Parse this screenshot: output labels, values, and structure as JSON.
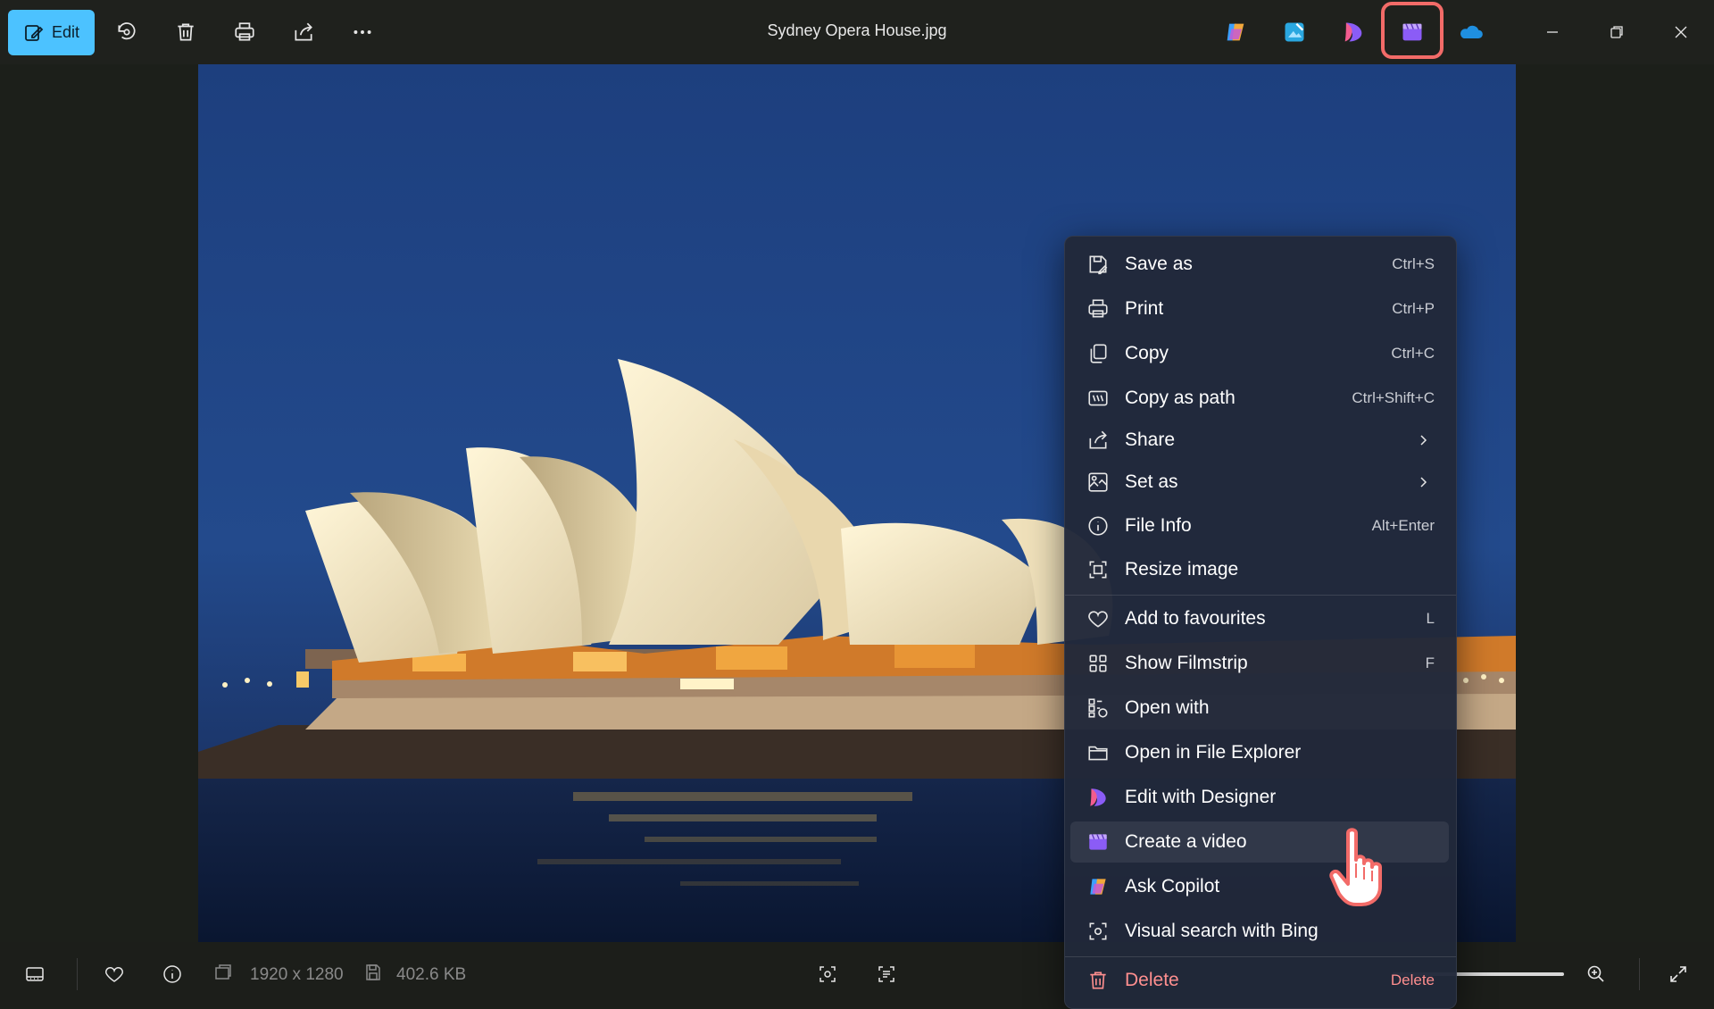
{
  "window": {
    "title": "Sydney Opera House.jpg"
  },
  "toolbar": {
    "edit_label": "Edit",
    "icons": [
      "rotate-icon",
      "delete-icon",
      "print-icon",
      "share-icon",
      "more-icon"
    ],
    "apps": [
      "copilot-icon",
      "photos-editor-icon",
      "designer-icon",
      "clipchamp-icon",
      "onedrive-icon"
    ],
    "highlighted_app": "clipchamp-icon"
  },
  "status": {
    "resolution": "1920 x 1280",
    "file_size": "402.6 KB"
  },
  "menu": {
    "items": [
      {
        "label": "Save as",
        "shortcut": "Ctrl+S",
        "icon": "save-as-icon"
      },
      {
        "label": "Print",
        "shortcut": "Ctrl+P",
        "icon": "print-icon"
      },
      {
        "label": "Copy",
        "shortcut": "Ctrl+C",
        "icon": "copy-icon"
      },
      {
        "label": "Copy as path",
        "shortcut": "Ctrl+Shift+C",
        "icon": "copy-path-icon"
      },
      {
        "label": "Share",
        "shortcut": "",
        "icon": "share-icon",
        "submenu": true
      },
      {
        "label": "Set as",
        "shortcut": "",
        "icon": "set-as-icon",
        "submenu": true
      },
      {
        "label": "File Info",
        "shortcut": "Alt+Enter",
        "icon": "info-icon"
      },
      {
        "label": "Resize image",
        "shortcut": "",
        "icon": "resize-icon"
      },
      {
        "label": "Add to favourites",
        "shortcut": "L",
        "icon": "heart-icon"
      },
      {
        "label": "Show Filmstrip",
        "shortcut": "F",
        "icon": "filmstrip-icon"
      },
      {
        "label": "Open with",
        "shortcut": "",
        "icon": "open-with-icon"
      },
      {
        "label": "Open in File Explorer",
        "shortcut": "",
        "icon": "folder-icon"
      },
      {
        "label": "Edit with Designer",
        "shortcut": "",
        "icon": "designer-icon"
      },
      {
        "label": "Create a video",
        "shortcut": "",
        "icon": "clipchamp-icon",
        "hover": true
      },
      {
        "label": "Ask Copilot",
        "shortcut": "",
        "icon": "copilot-icon"
      },
      {
        "label": "Visual search with Bing",
        "shortcut": "",
        "icon": "visual-search-icon"
      },
      {
        "label": "Delete",
        "shortcut": "Delete",
        "icon": "delete-icon",
        "danger": true
      }
    ]
  },
  "colors": {
    "accent": "#4cc2ff",
    "highlight": "#f26b68",
    "menu_bg": "#21283a",
    "danger": "#ff8f8f"
  }
}
